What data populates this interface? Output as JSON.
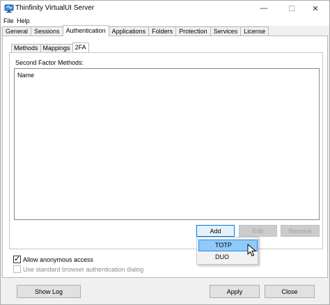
{
  "window": {
    "title": "Thinfinity VirtualUI Server",
    "controls": {
      "minimize": "—",
      "maximize": "☐",
      "close": "✕"
    }
  },
  "menu": {
    "items": [
      "File",
      "Help"
    ]
  },
  "tabs": [
    "General",
    "Sessions",
    "Authentication",
    "Applications",
    "Folders",
    "Protection",
    "Services",
    "License"
  ],
  "active_tab": "Authentication",
  "subtabs": [
    "Methods",
    "Mappings",
    "2FA"
  ],
  "active_subtab": "2FA",
  "second_factor": {
    "section_label": "Second Factor Methods:",
    "column_header": "Name",
    "rows": []
  },
  "buttons": {
    "add": "Add",
    "edit": "Edit",
    "remove": "Remove",
    "show_log": "Show Log",
    "apply": "Apply",
    "close": "Close"
  },
  "add_menu": {
    "items": [
      "TOTP",
      "DUO"
    ],
    "hovered": "TOTP"
  },
  "options": {
    "allow_anonymous": {
      "label": "Allow anonymous access",
      "checked": true
    },
    "browser_auth": {
      "label": "Use standard browser authentication dialog",
      "checked": false,
      "disabled": true
    }
  },
  "colors": {
    "accent": "#0078d7",
    "hover": "#91c9f7"
  },
  "icons": {
    "app": "app-logo-icon",
    "cursor": "mouse-pointer-icon"
  }
}
